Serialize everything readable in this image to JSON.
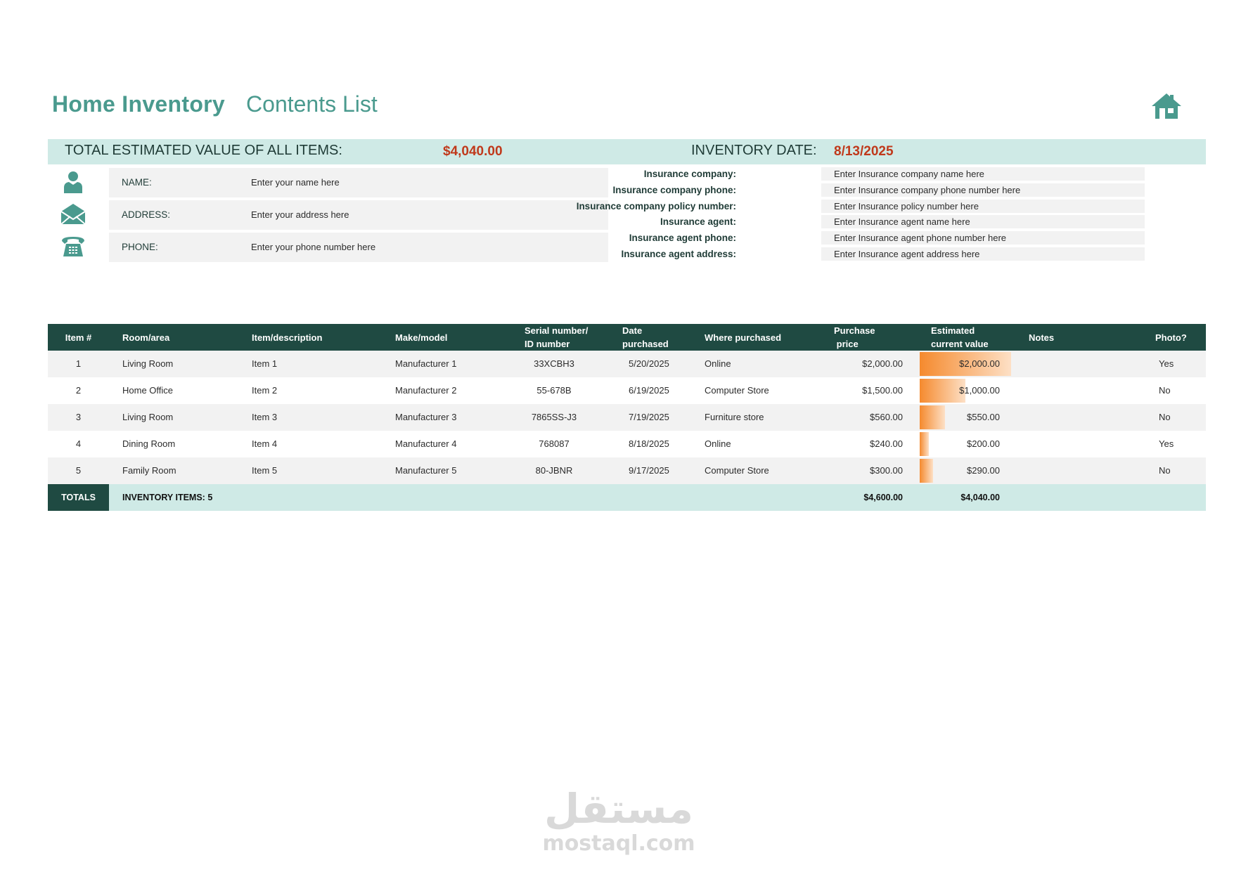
{
  "header": {
    "title": "Home Inventory",
    "subtitle": "Contents List",
    "icon": "home-icon"
  },
  "summary": {
    "total_label": "TOTAL ESTIMATED VALUE OF ALL ITEMS:",
    "total_value": "$4,040.00",
    "date_label": "INVENTORY DATE:",
    "date_value": "8/13/2025"
  },
  "contact": [
    {
      "icon": "person-icon",
      "label": "NAME:",
      "value": "Enter your name here"
    },
    {
      "icon": "envelope-icon",
      "label": "ADDRESS:",
      "value": "Enter your address here"
    },
    {
      "icon": "phone-icon",
      "label": "PHONE:",
      "value": "Enter your phone number here"
    }
  ],
  "insurance": [
    {
      "label": "Insurance company:",
      "value": "Enter Insurance company name here"
    },
    {
      "label": "Insurance company phone:",
      "value": "Enter Insurance company phone number here"
    },
    {
      "label": "Insurance company policy number:",
      "value": "Enter Insurance policy number here"
    },
    {
      "label": "Insurance agent:",
      "value": "Enter Insurance agent name here"
    },
    {
      "label": "Insurance agent phone:",
      "value": "Enter Insurance agent phone number here"
    },
    {
      "label": "Insurance agent address:",
      "value": "Enter Insurance agent address here"
    }
  ],
  "table": {
    "columns": {
      "item": "Item #",
      "room": "Room/area",
      "desc": "Item/description",
      "make": "Make/model",
      "serial_1": "Serial number/",
      "serial_2": "ID number",
      "date_1": "Date",
      "date_2": "purchased",
      "where": "Where purchased",
      "price_1": "Purchase",
      "price_2": "price",
      "est_1": "Estimated",
      "est_2": "current value",
      "notes": "Notes",
      "photo": "Photo?"
    },
    "rows": [
      {
        "item": "1",
        "room": "Living Room",
        "desc": "Item 1",
        "make": "Manufacturer 1",
        "serial": "33XCBH3",
        "date": "5/20/2025",
        "where": "Online",
        "price": "$2,000.00",
        "est": "$2,000.00",
        "est_fraction": 1.0,
        "notes": "",
        "photo": "Yes"
      },
      {
        "item": "2",
        "room": "Home Office",
        "desc": "Item 2",
        "make": "Manufacturer 2",
        "serial": "55-678B",
        "date": "6/19/2025",
        "where": "Computer Store",
        "price": "$1,500.00",
        "est": "$1,000.00",
        "est_fraction": 0.5,
        "notes": "",
        "photo": "No"
      },
      {
        "item": "3",
        "room": "Living Room",
        "desc": "Item 3",
        "make": "Manufacturer 3",
        "serial": "7865SS-J3",
        "date": "7/19/2025",
        "where": "Furniture store",
        "price": "$560.00",
        "est": "$550.00",
        "est_fraction": 0.275,
        "notes": "",
        "photo": "No"
      },
      {
        "item": "4",
        "room": "Dining Room",
        "desc": "Item 4",
        "make": "Manufacturer 4",
        "serial": "768087",
        "date": "8/18/2025",
        "where": "Online",
        "price": "$240.00",
        "est": "$200.00",
        "est_fraction": 0.1,
        "notes": "",
        "photo": "Yes"
      },
      {
        "item": "5",
        "room": "Family Room",
        "desc": "Item 5",
        "make": "Manufacturer 5",
        "serial": "80-JBNR",
        "date": "9/17/2025",
        "where": "Computer Store",
        "price": "$300.00",
        "est": "$290.00",
        "est_fraction": 0.145,
        "notes": "",
        "photo": "No"
      }
    ],
    "totals": {
      "label": "TOTALS",
      "items_label": "INVENTORY ITEMS: 5",
      "price": "$4,600.00",
      "est": "$4,040.00"
    }
  },
  "watermark": {
    "arabic": "مستقل",
    "latin": "mostaql.com"
  },
  "colors": {
    "accent": "#4a9a8e",
    "header_dark": "#1f4a42",
    "light_teal": "#cfeae6",
    "highlight_red": "#c0391b",
    "bar_orange": "#f58a2e"
  }
}
